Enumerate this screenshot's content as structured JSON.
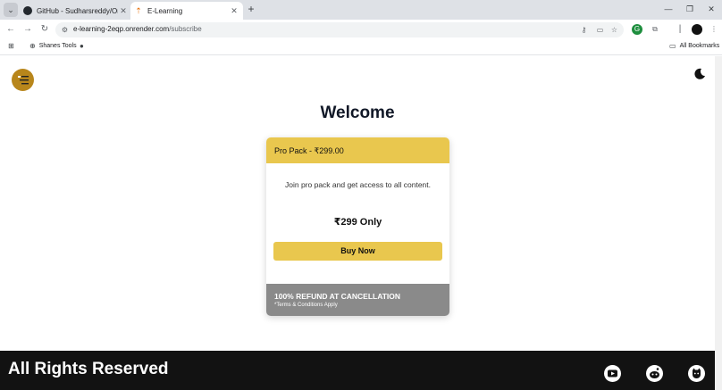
{
  "browser": {
    "tabs": [
      {
        "title": "GitHub - Sudharsreddy/Online",
        "active": false
      },
      {
        "title": "E-Learning",
        "active": true
      }
    ],
    "url_host": "e-learning-2eqp.onrender.com",
    "url_path": "/subscribe",
    "bookmarks": [
      {
        "label": "Shanes Tools"
      }
    ],
    "all_bookmarks_label": "All Bookmarks"
  },
  "page": {
    "heading": "Welcome",
    "plan": {
      "header": "Pro Pack - ₹299.00",
      "description": "Join pro pack and get access to all content.",
      "price": "₹299 Only",
      "cta": "Buy Now",
      "refund_title": "100% REFUND AT CANCELLATION",
      "refund_note": "*Terms & Conditions Apply"
    },
    "footer": {
      "text": "All Rights Reserved",
      "social": [
        "youtube-icon",
        "reddit-icon",
        "github-icon"
      ]
    }
  },
  "colors": {
    "accent": "#e9c74e",
    "menu_button": "#b8861b",
    "footer_bg": "#121212",
    "refund_bg": "#8a8a8a"
  }
}
